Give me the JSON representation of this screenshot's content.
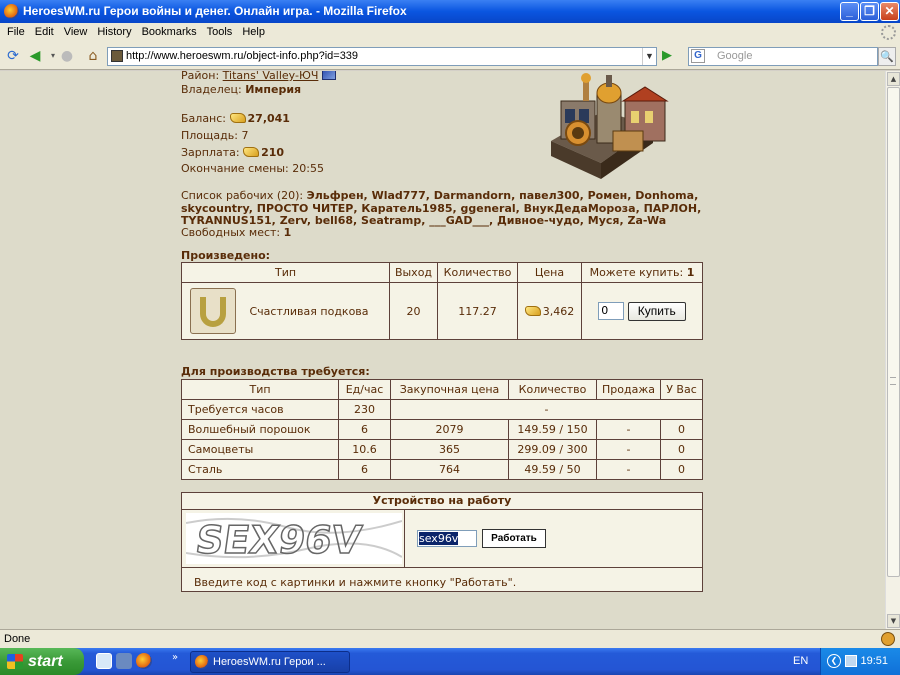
{
  "window": {
    "title": "HeroesWM.ru Герои войны и денег. Онлайн игра. - Mozilla Firefox"
  },
  "menu": [
    "File",
    "Edit",
    "View",
    "History",
    "Bookmarks",
    "Tools",
    "Help"
  ],
  "nav": {
    "url": "http://www.heroeswm.ru/object-info.php?id=339",
    "search_placeholder": "Google"
  },
  "info": {
    "district_label": "Район:",
    "district_link": "Titans' Valley-ЮЧ",
    "owner_label": "Владелец:",
    "owner": "Империя",
    "balance_label": "Баланс:",
    "balance": "27,041",
    "area_label": "Площадь:",
    "area": "7",
    "salary_label": "Зарплата:",
    "salary": "210",
    "shift_end": "Окончание смены: 20:55",
    "workers_label": "Список рабочих (20):",
    "workers_line1": "Эльфрен, Wlad777, Darmandorn, павел300, Ромен, Donhoma,",
    "workers_line2": "skycountry, ПРОСТО ЧИТЕР, Каратель1985, ggeneral, ВнукДедаМороза, ПАРЛОН,",
    "workers_line3": "TYRANNUS151, Zerv, bell68, Seatramp, ___GAD___, Дивное-чудо, Муся, Za-Wa",
    "free_label": "Свободных мест:",
    "free": "1"
  },
  "produced": {
    "title": "Произведено:",
    "headers": [
      "Тип",
      "Выход",
      "Количество",
      "Цена",
      "Можете купить:"
    ],
    "can_buy": "1",
    "item": {
      "name": "Счастливая подкова",
      "output": "20",
      "quantity": "117.27",
      "price": "3,462",
      "qty_input": "0",
      "buy_label": "Купить"
    }
  },
  "required": {
    "title": "Для производства требуется:",
    "headers": [
      "Тип",
      "Ед/час",
      "Закупочная цена",
      "Количество",
      "Продажа",
      "У Вас"
    ],
    "hours_row": {
      "type": "Требуется часов",
      "rate": "230",
      "rest": "-"
    },
    "rows": [
      {
        "type": "Волшебный порошок",
        "rate": "6",
        "buy_price": "2079",
        "quantity": "149.59 / 150",
        "sale": "-",
        "have": "0"
      },
      {
        "type": "Самоцветы",
        "rate": "10.6",
        "buy_price": "365",
        "quantity": "299.09 / 300",
        "sale": "-",
        "have": "0"
      },
      {
        "type": "Сталь",
        "rate": "6",
        "buy_price": "764",
        "quantity": "49.59 / 50",
        "sale": "-",
        "have": "0"
      }
    ]
  },
  "job": {
    "title": "Устройство на работу",
    "captcha_text": "SEX96V",
    "code_value": "sex96v",
    "work_label": "Работать",
    "note": "Введите код с картинки и нажмите кнопку \"Работать\"."
  },
  "status": {
    "text": "Done"
  },
  "taskbar": {
    "start": "start",
    "task": "HeroesWM.ru Герои ...",
    "lang": "EN",
    "clock": "19:51"
  }
}
